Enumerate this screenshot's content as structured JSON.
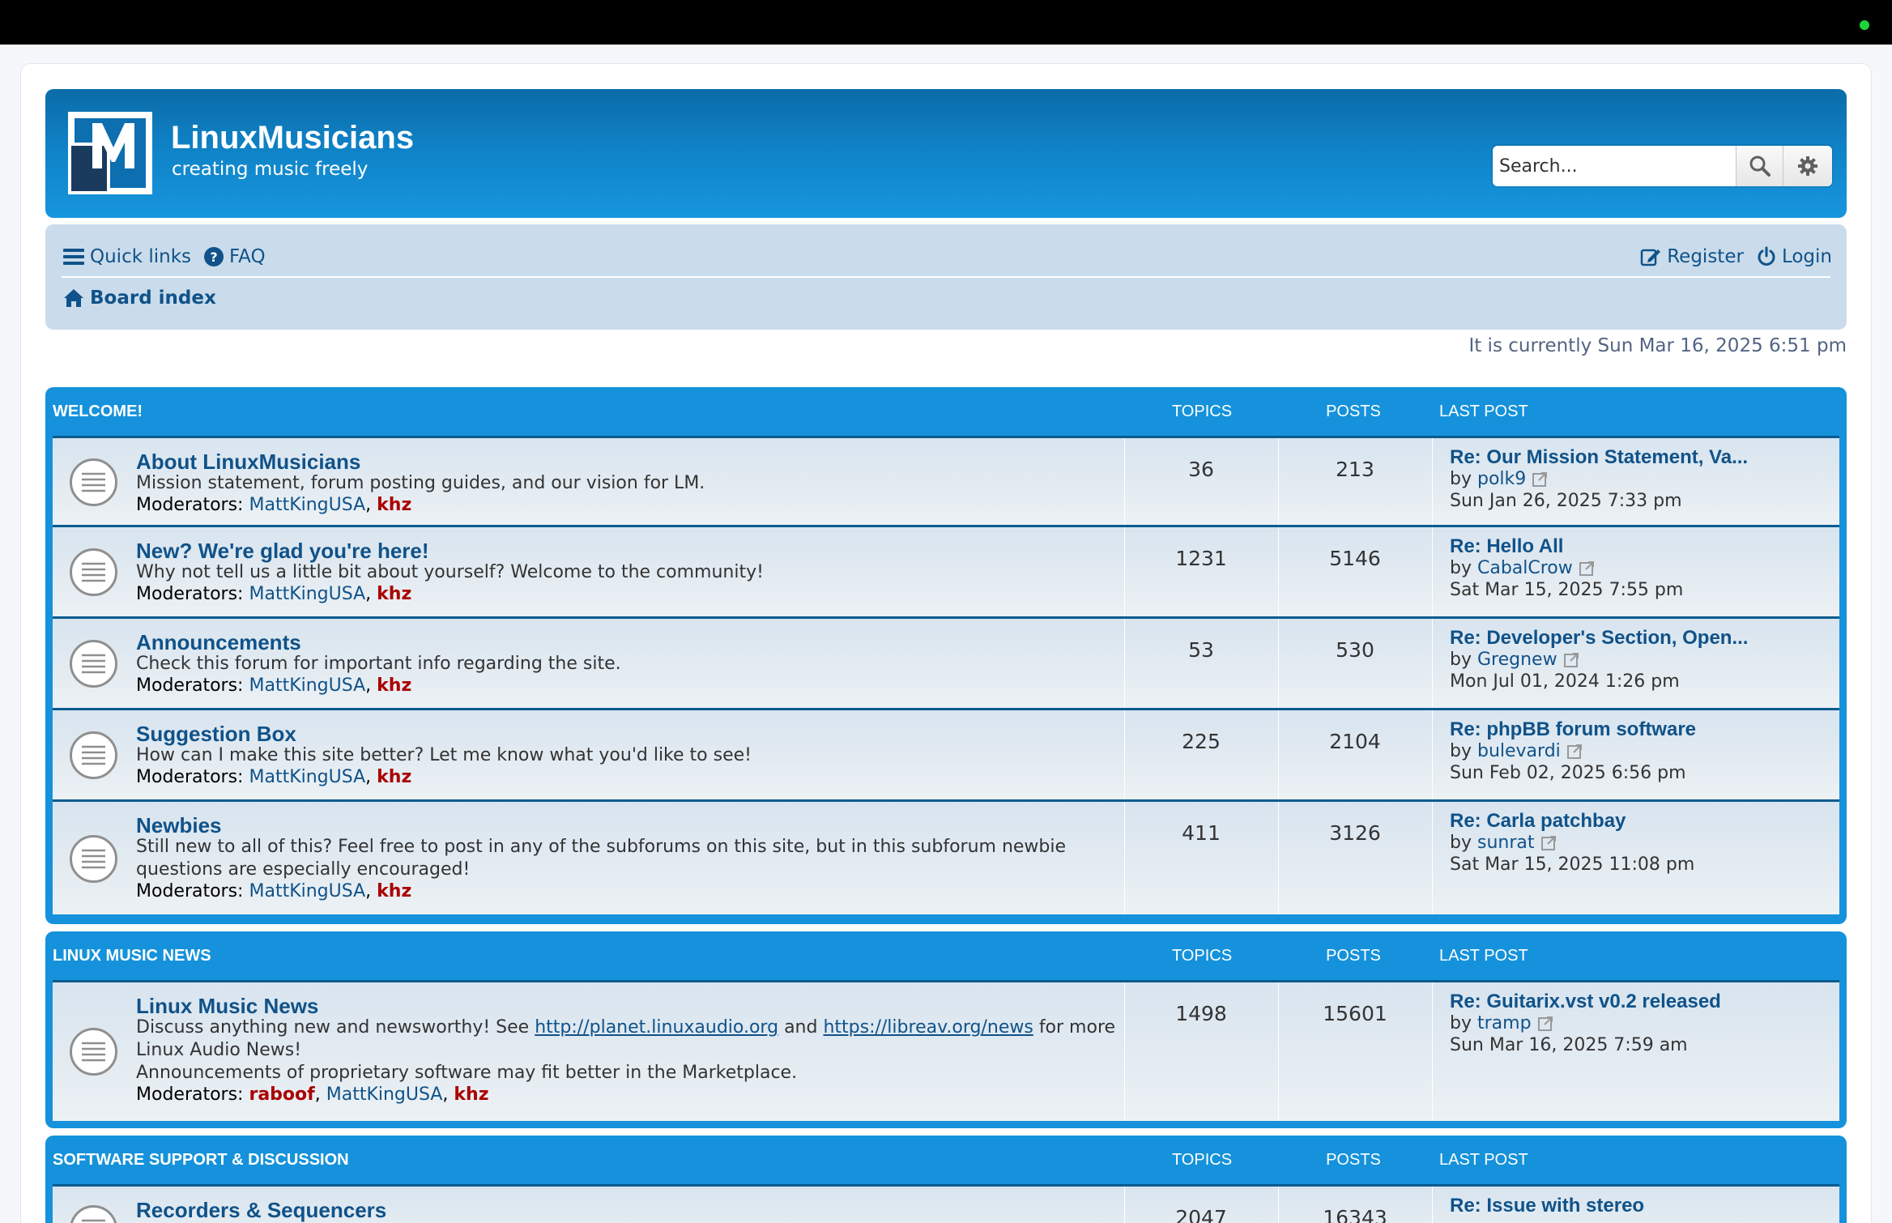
{
  "header": {
    "site_title": "LinuxMusicians",
    "tagline": "creating music freely",
    "search_placeholder": "Search..."
  },
  "nav": {
    "quick_links": "Quick links",
    "faq": "FAQ",
    "register": "Register",
    "login": "Login",
    "board_index": "Board index"
  },
  "current_time": "It is currently Sun Mar 16, 2025 6:51 pm",
  "columns": {
    "topics": "TOPICS",
    "posts": "POSTS",
    "last_post": "LAST POST"
  },
  "categories": [
    {
      "name": "WELCOME!",
      "forums": [
        {
          "title": "About LinuxMusicians",
          "desc": "Mission statement, forum posting guides, and our vision for LM.",
          "mods_label": "Moderators:",
          "mod1": "MattKingUSA",
          "mod2": "khz",
          "topics": "36",
          "posts": "213",
          "lp_title": "Re: Our Mission Statement, Va...",
          "lp_by": "by",
          "lp_user": "polk9",
          "lp_date": "Sun Jan 26, 2025 7:33 pm"
        },
        {
          "title": "New? We're glad you're here!",
          "desc": "Why not tell us a little bit about yourself? Welcome to the community!",
          "mods_label": "Moderators:",
          "mod1": "MattKingUSA",
          "mod2": "khz",
          "topics": "1231",
          "posts": "5146",
          "lp_title": "Re: Hello All",
          "lp_by": "by",
          "lp_user": "CabalCrow",
          "lp_date": "Sat Mar 15, 2025 7:55 pm"
        },
        {
          "title": "Announcements",
          "desc": "Check this forum for important info regarding the site.",
          "mods_label": "Moderators:",
          "mod1": "MattKingUSA",
          "mod2": "khz",
          "topics": "53",
          "posts": "530",
          "lp_title": "Re: Developer's Section, Open...",
          "lp_by": "by",
          "lp_user": "Gregnew",
          "lp_date": "Mon Jul 01, 2024 1:26 pm"
        },
        {
          "title": "Suggestion Box",
          "desc": "How can I make this site better? Let me know what you'd like to see!",
          "mods_label": "Moderators:",
          "mod1": "MattKingUSA",
          "mod2": "khz",
          "topics": "225",
          "posts": "2104",
          "lp_title": "Re: phpBB forum software",
          "lp_by": "by",
          "lp_user": "bulevardi",
          "lp_date": "Sun Feb 02, 2025 6:56 pm"
        },
        {
          "title": "Newbies",
          "desc": "Still new to all of this? Feel free to post in any of the subforums on this site, but in this subforum newbie questions are especially encouraged!",
          "mods_label": "Moderators:",
          "mod1": "MattKingUSA",
          "mod2": "khz",
          "topics": "411",
          "posts": "3126",
          "lp_title": "Re: Carla patchbay",
          "lp_by": "by",
          "lp_user": "sunrat",
          "lp_date": "Sat Mar 15, 2025 11:08 pm"
        }
      ]
    },
    {
      "name": "LINUX MUSIC NEWS",
      "forums": [
        {
          "title": "Linux Music News",
          "desc_pre": "Discuss anything new and newsworthy! See",
          "link1": "http://planet.linuxaudio.org",
          "desc_mid": "and",
          "link2": "https://libreav.org/news",
          "desc_post": "for more Linux Audio News!",
          "desc2": "Announcements of proprietary software may fit better in the Marketplace.",
          "mods_label": "Moderators:",
          "mod0": "raboof",
          "mod1": "MattKingUSA",
          "mod2": "khz",
          "topics": "1498",
          "posts": "15601",
          "lp_title": "Re: Guitarix.vst v0.2 released",
          "lp_by": "by",
          "lp_user": "tramp",
          "lp_date": "Sun Mar 16, 2025 7:59 am"
        }
      ]
    },
    {
      "name": "SOFTWARE SUPPORT & DISCUSSION",
      "forums": [
        {
          "title": "Recorders & Sequencers",
          "topics": "2047",
          "posts": "16343",
          "lp_title": "Re: Issue with stereo"
        }
      ]
    }
  ]
}
